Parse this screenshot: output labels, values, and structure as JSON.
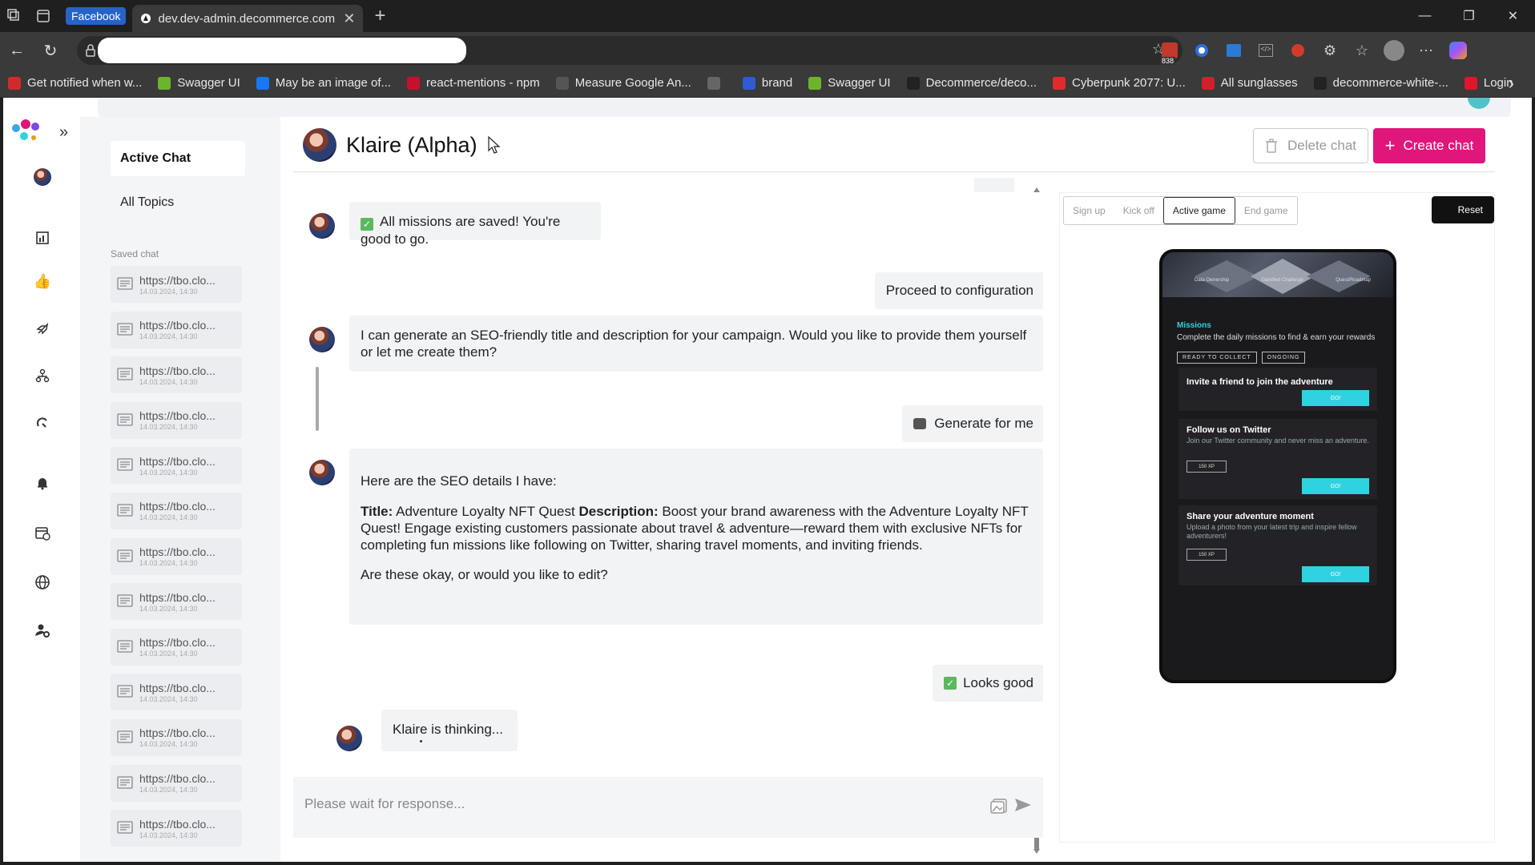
{
  "browser": {
    "tab_group": "Facebook",
    "tab_title": "dev.dev-admin.decommerce.com",
    "ext_badge": "838",
    "bookmarks": [
      {
        "label": "Get notified when w...",
        "color": "#d02b2b"
      },
      {
        "label": "Swagger UI",
        "color": "#6bb42b"
      },
      {
        "label": "May be an image of...",
        "color": "#1877f2"
      },
      {
        "label": "react-mentions - npm",
        "color": "#c8102e"
      },
      {
        "label": "Measure Google An...",
        "color": "#555555"
      },
      {
        "label": "",
        "color": "#666666"
      },
      {
        "label": "brand",
        "color": "#2f5bd4"
      },
      {
        "label": "Swagger UI",
        "color": "#6bb42b"
      },
      {
        "label": "Decommerce/deco...",
        "color": "#222222"
      },
      {
        "label": "Cyberpunk 2077: U...",
        "color": "#e12b2b"
      },
      {
        "label": "All sunglasses",
        "color": "#d0202b"
      },
      {
        "label": "decommerce-white-...",
        "color": "#222222"
      },
      {
        "label": "Login",
        "color": "#e0162b"
      }
    ]
  },
  "sidebar": {
    "active_chat": "Active Chat",
    "all_topics": "All Topics",
    "saved_label": "Saved chat",
    "saved_items": [
      {
        "url": "https://tbo.clo...",
        "date": "14.03.2024, 14:30"
      },
      {
        "url": "https://tbo.clo...",
        "date": "14.03.2024, 14:30"
      },
      {
        "url": "https://tbo.clo...",
        "date": "14.03.2024, 14:30"
      },
      {
        "url": "https://tbo.clo...",
        "date": "14.03.2024, 14:30"
      },
      {
        "url": "https://tbo.clo...",
        "date": "14.03.2024, 14:30"
      },
      {
        "url": "https://tbo.clo...",
        "date": "14.03.2024, 14:30"
      },
      {
        "url": "https://tbo.clo...",
        "date": "14.03.2024, 14:30"
      },
      {
        "url": "https://tbo.clo...",
        "date": "14.03.2024, 14:30"
      },
      {
        "url": "https://tbo.clo...",
        "date": "14.03.2024, 14:30"
      },
      {
        "url": "https://tbo.clo...",
        "date": "14.03.2024, 14:30"
      },
      {
        "url": "https://tbo.clo...",
        "date": "14.03.2024, 14:30"
      },
      {
        "url": "https://tbo.clo...",
        "date": "14.03.2024, 14:30"
      },
      {
        "url": "https://tbo.clo...",
        "date": "14.03.2024, 14:30"
      }
    ]
  },
  "header": {
    "title": "Klaire (Alpha)",
    "delete_label": "Delete chat",
    "create_label": "Create chat",
    "accent": "#e0167a"
  },
  "chat": {
    "m1": "All missions are saved! You're good to go.",
    "u1": "Proceed to configuration",
    "m2": "I can generate an SEO-friendly title and description for your campaign. Would you like to provide them yourself or let me create them?",
    "u2": "Generate for me",
    "m3_intro": "Here are the SEO details I have:",
    "m3_title_label": "Title:",
    "m3_title": "Adventure Loyalty NFT Quest",
    "m3_desc_label": "Description:",
    "m3_desc": "Boost your brand awareness with the Adventure Loyalty NFT Quest! Engage existing customers passionate about travel & adventure—reward them with exclusive NFTs for completing fun missions like following on Twitter, sharing travel moments, and inviting friends.",
    "m3_question": "Are these okay, or would you like to edit?",
    "u3": "Looks good",
    "thinking": "Klaire is thinking...",
    "input_placeholder": "Please wait for response..."
  },
  "preview": {
    "tabs": [
      "Sign up",
      "Kick off",
      "Active game",
      "End game"
    ],
    "active_tab": "Active game",
    "reset_label": "Reset",
    "banner_labels": [
      "Data Ownership",
      "Gamified Challenge",
      "Quest/Roadmap"
    ],
    "missions_title": "Missions",
    "missions_sub": "Complete the daily missions to find & earn your rewards",
    "pills": [
      "READY TO COLLECT",
      "ONGOING"
    ],
    "cards": [
      {
        "title": "Invite a friend to join the adventure",
        "desc": "",
        "xp": "",
        "go": "GO!"
      },
      {
        "title": "Follow us on Twitter",
        "desc": "Join our Twitter community and never miss an adventure.",
        "xp": "150 XP",
        "go": "GO!"
      },
      {
        "title": "Share your adventure moment",
        "desc": "Upload a photo from your latest trip and inspire fellow adventurers!",
        "xp": "150 XP",
        "go": "GO!"
      }
    ],
    "accent": "#2fd2e0"
  }
}
